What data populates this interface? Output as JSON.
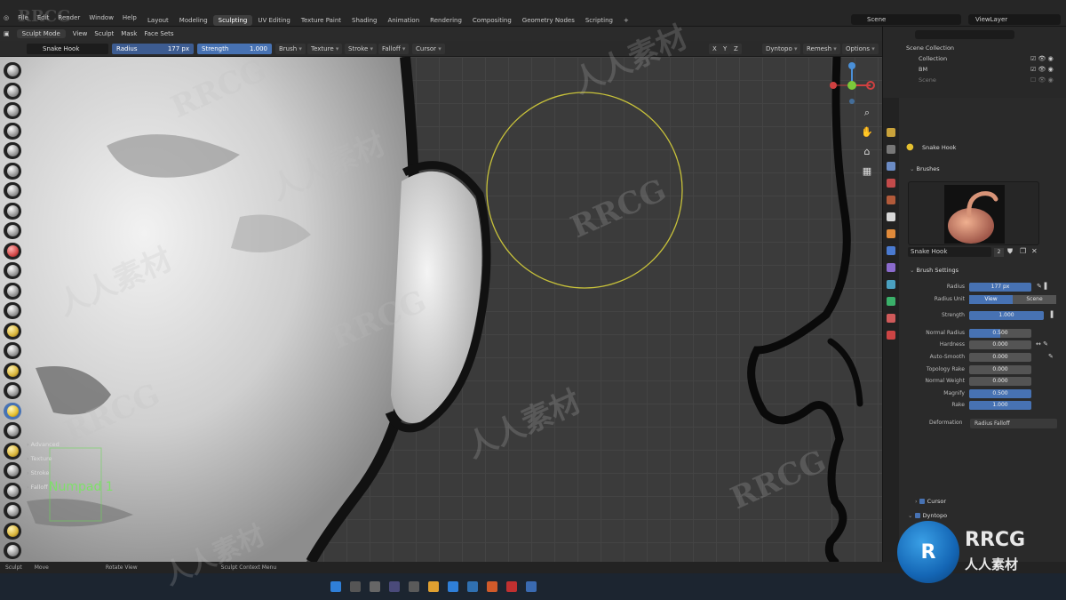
{
  "menu": {
    "items": [
      "File",
      "Edit",
      "Render",
      "Window",
      "Help"
    ]
  },
  "workspaces": {
    "tabs": [
      "Layout",
      "Modeling",
      "Sculpting",
      "UV Editing",
      "Texture Paint",
      "Shading",
      "Animation",
      "Rendering",
      "Compositing",
      "Geometry Nodes",
      "Scripting"
    ],
    "active": "Sculpting"
  },
  "scene": {
    "name": "Scene",
    "view_layer": "ViewLayer"
  },
  "viewport_header": {
    "mode": "Sculpt Mode",
    "menus": [
      "View",
      "Sculpt",
      "Mask",
      "Face Sets"
    ]
  },
  "tool_header": {
    "brush_name": "Snake Hook",
    "radius_label": "Radius",
    "radius_value": "177 px",
    "strength_label": "Strength",
    "strength_value": "1.000",
    "dropdowns": [
      "Brush",
      "Texture",
      "Stroke",
      "Falloff",
      "Cursor"
    ],
    "right_dropdowns": [
      "Dyntopo",
      "Remesh",
      "Options"
    ],
    "axes": [
      "X",
      "Y",
      "Z"
    ]
  },
  "viewport": {
    "overlay_text": "Numpad 1"
  },
  "outliner": {
    "root": "Scene Collection",
    "items": [
      "Collection",
      "BM",
      "Scene"
    ]
  },
  "properties": {
    "title": "Snake Hook",
    "sections": {
      "brushes": "Brushes",
      "brush_settings": "Brush Settings"
    },
    "brush_field": "Snake Hook",
    "brush_users": "2",
    "rows": [
      {
        "label": "Radius",
        "value": "177 px",
        "fill": 1.0
      },
      {
        "label": "Strength",
        "value": "1.000",
        "fill": 1.0
      },
      {
        "label": "Normal Radius",
        "value": "0.500",
        "fill": 0.5
      },
      {
        "label": "Hardness",
        "value": "0.000",
        "fill": 0.0
      },
      {
        "label": "Auto-Smooth",
        "value": "0.000",
        "fill": 0.0
      },
      {
        "label": "Topology Rake",
        "value": "0.000",
        "fill": 0.0
      },
      {
        "label": "Normal Weight",
        "value": "0.000",
        "fill": 0.0
      },
      {
        "label": "Magnify",
        "value": "0.500",
        "fill": 1.0
      },
      {
        "label": "Rake",
        "value": "1.000",
        "fill": 1.0
      }
    ],
    "radius_unit": {
      "label": "Radius Unit",
      "options": [
        "View",
        "Scene"
      ],
      "selected": "View"
    },
    "deformation": {
      "label": "Deformation",
      "value": "Radius Falloff"
    },
    "collapsed_sections": [
      "Advanced",
      "Texture",
      "Stroke",
      "Falloff",
      "Cursor"
    ],
    "dyntopo_section": "Dyntopo"
  },
  "statusbar": {
    "items": [
      "Sculpt",
      "Move",
      "Rotate View",
      "Sculpt Context Menu"
    ]
  },
  "watermark": {
    "text": "RRCG",
    "cn": "人人素材"
  },
  "colors": {
    "accent": "#4772b3",
    "brush_circle": "#c8c23a",
    "numpad_text": "#7fe06a"
  }
}
